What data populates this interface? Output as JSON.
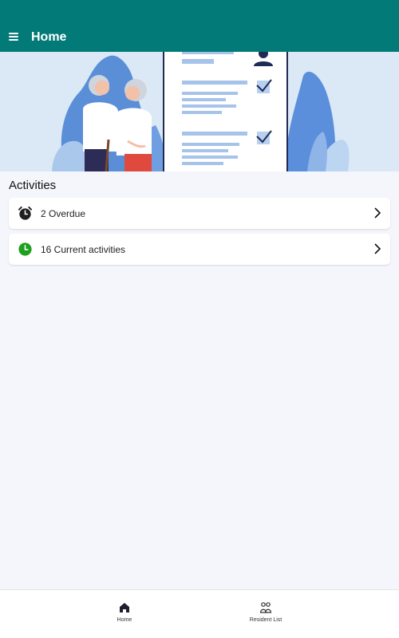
{
  "app_bar": {
    "title": "Home",
    "menu_icon": "hamburger-menu-icon",
    "background": "#017a78"
  },
  "banner": {
    "illustration": "elderly-couple-checklist-illustration"
  },
  "activities": {
    "section_title": "Activities",
    "items": [
      {
        "label": "2  Overdue",
        "icon": "alarm-clock-icon",
        "icon_color": "#1f1f1f"
      },
      {
        "label": "16 Current activities",
        "icon": "clock-icon",
        "icon_color": "#1ea01e"
      }
    ]
  },
  "bottom_nav": {
    "items": [
      {
        "label": "Home",
        "icon": "home-icon",
        "active": true
      },
      {
        "label": "Resident List",
        "icon": "residents-icon",
        "active": false
      }
    ]
  }
}
